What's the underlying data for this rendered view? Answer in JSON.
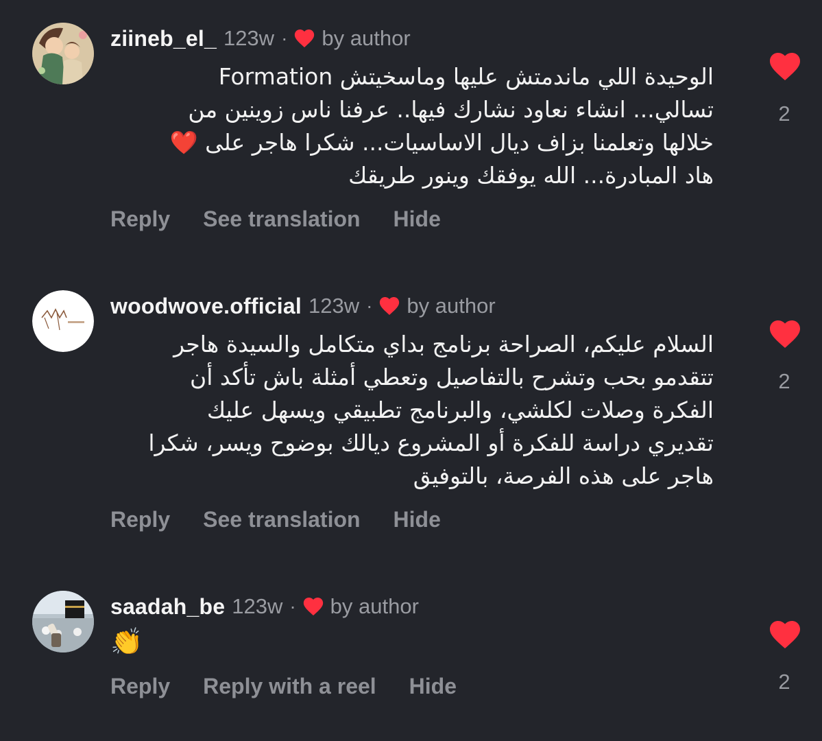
{
  "comments": [
    {
      "username": "ziineb_el_",
      "time": "123w",
      "separator": "·",
      "by_author": "by author",
      "lines": [
        "الوحيدة اللي ماندمتش عليها وماسخيتش Formation",
        "تسالي... انشاء نعاود نشارك فيها.. عرفنا ناس زوينين من",
        "خلالها وتعلمنا بزاف ديال الاساسيات... شكرا هاجر على ❤️",
        "هاد المبادرة... الله يوفقك وينور طريقك"
      ],
      "actions": [
        "Reply",
        "See translation",
        "Hide"
      ],
      "likes": "2",
      "avatar": "avatar-illustration-mother-child"
    },
    {
      "username": "woodwove.official",
      "time": "123w",
      "separator": "·",
      "by_author": "by author",
      "lines": [
        "السلام عليكم،  الصراحة برنامج بداي متكامل والسيدة هاجر",
        "تتقدمو بحب وتشرح بالتفاصيل وتعطي أمثلة باش تأكد أن",
        "الفكرة وصلات لكلشي، والبرنامج تطبيقي ويسهل عليك",
        "تقديري دراسة للفكرة أو المشروع ديالك بوضوح ويسر، شكرا",
        "هاجر على هذه الفرصة، بالتوفيق"
      ],
      "actions": [
        "Reply",
        "See translation",
        "Hide"
      ],
      "likes": "2",
      "avatar": "avatar-brand-logo"
    },
    {
      "username": "saadah_be",
      "time": "123w",
      "separator": "·",
      "by_author": "by author",
      "emoji": "👏",
      "actions": [
        "Reply",
        "Reply with a reel",
        "Hide"
      ],
      "likes": "2",
      "avatar": "avatar-photo-kaaba"
    }
  ],
  "colors": {
    "background": "#23252b",
    "heart": "#ff3040",
    "muted": "#9a9ca2",
    "text": "#f2f2f2"
  }
}
